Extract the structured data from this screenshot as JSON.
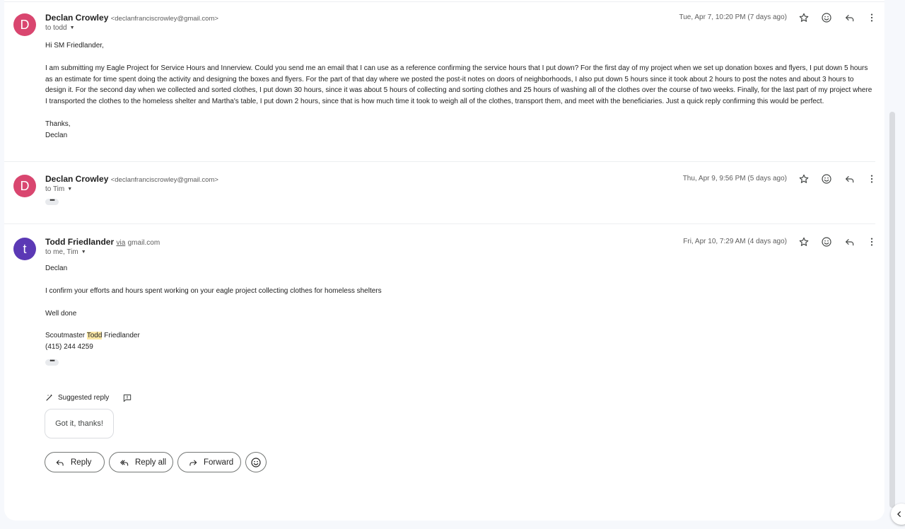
{
  "messages": [
    {
      "avatar_letter": "D",
      "avatar_color": "#d9466f",
      "sender_name": "Declan Crowley",
      "sender_email": "<declanfranciscrowley@gmail.com>",
      "to_line": "to todd",
      "date": "Tue, Apr 7, 10:20 PM (7 days ago)",
      "body": [
        "Hi SM Friedlander,",
        "I am submitting my Eagle Project for Service Hours and Innerview. Could you send me an email that I can use as a reference confirming the service hours that I put down? For the first day of my project when we set up donation boxes and flyers, I put down 5 hours as an estimate for time spent doing the activity and designing the boxes and flyers. For the part of that day where we posted the post-it notes on doors of neighborhoods, I also put down 5 hours since it took about 2 hours to post the notes and about 3 hours to design it. For the second day when we collected and sorted clothes, I put down 30 hours, since it was about 5 hours of collecting and sorting clothes and 25 hours of washing all of the clothes over the course of two weeks. Finally, for the last part of my project where I transported the clothes to the homeless shelter and Martha's table, I put down 2 hours, since that is how much time it took to weigh all of the clothes, transport them, and meet with the beneficiaries. Just a quick reply confirming this would be perfect.",
        "Thanks,",
        "Declan"
      ]
    },
    {
      "avatar_letter": "D",
      "avatar_color": "#d9466f",
      "sender_name": "Declan Crowley",
      "sender_email": "<declanfranciscrowley@gmail.com>",
      "to_line": "to Tim",
      "date": "Thu, Apr 9, 9:56 PM (5 days ago)",
      "ellipsis": "•••"
    },
    {
      "avatar_letter": "t",
      "avatar_color": "#5b39b5",
      "sender_name": "Todd Friedlander",
      "via": "via",
      "via_domain": "gmail.com",
      "to_line": "to me, Tim",
      "date": "Fri, Apr 10, 7:29 AM (4 days ago)",
      "body": [
        "Declan",
        "I confirm your efforts and hours spent working on your eagle project collecting clothes for homeless shelters",
        "Well done"
      ],
      "signature_prefix": "Scoutmaster",
      "signature_highlight": "Todd",
      "signature_suffix": "Friedlander",
      "phone": "(415) 244 4259",
      "ellipsis": "•••"
    }
  ],
  "suggested_reply": {
    "label": "Suggested reply",
    "chip": "Got it, thanks!"
  },
  "actions": {
    "reply": "Reply",
    "reply_all": "Reply all",
    "forward": "Forward"
  },
  "icons": {
    "star": "star-icon",
    "emoji": "emoji-icon",
    "reply": "reply-icon",
    "more": "more-vert-icon"
  }
}
